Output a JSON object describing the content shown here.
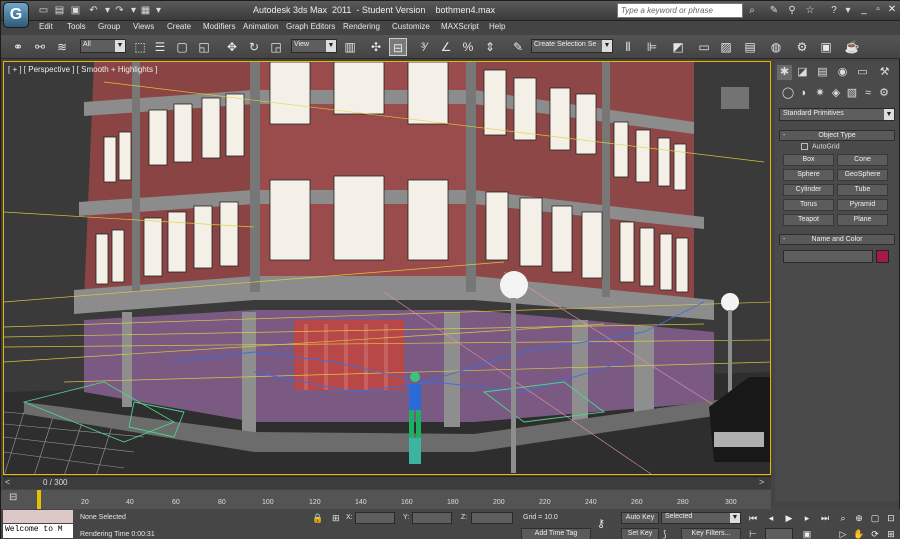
{
  "window": {
    "title": "Autodesk 3ds Max  2011  - Student Version    bothmen4.max",
    "search_placeholder": "Type a keyword or phrase",
    "logo_glyph": "G"
  },
  "menu": [
    "Edit",
    "Tools",
    "Group",
    "Views",
    "Create",
    "Modifiers",
    "Animation",
    "Graph Editors",
    "Rendering",
    "Customize",
    "MAXScript",
    "Help"
  ],
  "toolbar": {
    "selection_filter": "All",
    "ref_coord": "View",
    "named_selection": "Create Selection Se"
  },
  "viewport": {
    "label": "[ + ] [ Perspective ] [ Smooth + Highlights ]"
  },
  "command_panel": {
    "category": "Standard Primitives",
    "object_type_title": "Object Type",
    "autogrid": "AutoGrid",
    "primitives": [
      "Box",
      "Cone",
      "Sphere",
      "GeoSphere",
      "Cylinder",
      "Tube",
      "Torus",
      "Pyramid",
      "Teapot",
      "Plane"
    ],
    "name_color_title": "Name and Color",
    "swatch_color": "#a31b42"
  },
  "time": {
    "slider_label": "0 / 300",
    "ticks": [
      "20",
      "40",
      "60",
      "80",
      "100",
      "120",
      "140",
      "160",
      "180",
      "200",
      "220",
      "240",
      "260",
      "280",
      "300"
    ]
  },
  "status": {
    "maxscript": "Welcome to M",
    "selection": "None Selected",
    "prompt": "Rendering Time  0:00:31",
    "x_label": "X:",
    "y_label": "Y:",
    "z_label": "Z:",
    "grid": "Grid = 10.0",
    "add_time_tag": "Add Time Tag",
    "auto_key": "Auto Key",
    "set_key": "Set Key",
    "selected": "Selected",
    "key_filters": "Key Filters..."
  }
}
